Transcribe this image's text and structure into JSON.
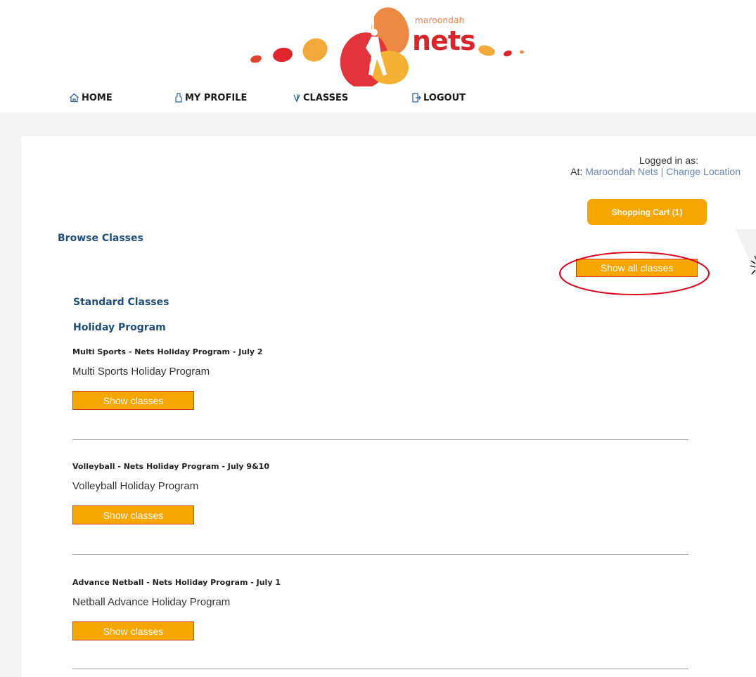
{
  "brand": {
    "small": "maroondah",
    "big": "nets"
  },
  "nav": {
    "home": "HOME",
    "profile": "MY PROFILE",
    "classes": "CLASSES",
    "logout": "LOGOUT"
  },
  "login": {
    "logged_in_label": "Logged in as:",
    "at_label": "At:",
    "location": "Maroondah Nets",
    "separator": "|",
    "change_location": "Change Location"
  },
  "cart": {
    "label": "Shopping Cart (1)"
  },
  "browse": {
    "title": "Browse Classes",
    "show_all_label": "Show all classes"
  },
  "categories": {
    "standard": "Standard Classes",
    "holiday": "Holiday Program"
  },
  "programs": [
    {
      "title": "Multi Sports - Nets Holiday Program - July 2",
      "description": "Multi Sports Holiday Program",
      "button": "Show classes"
    },
    {
      "title": "Volleyball - Nets Holiday Program - July 9&10",
      "description": "Volleyball Holiday Program",
      "button": "Show classes"
    },
    {
      "title": "Advance Netball - Nets Holiday Program - July 1",
      "description": "Netball Advance Holiday Program",
      "button": "Show classes"
    }
  ],
  "colors": {
    "accent_orange": "#f7a600",
    "heading_blue": "#1f4e79",
    "link_blue": "#6b86b3",
    "highlight_red": "#e0001b"
  },
  "icons": {
    "home": "home-icon",
    "profile": "profile-icon",
    "classes": "classes-icon",
    "logout": "logout-icon"
  }
}
